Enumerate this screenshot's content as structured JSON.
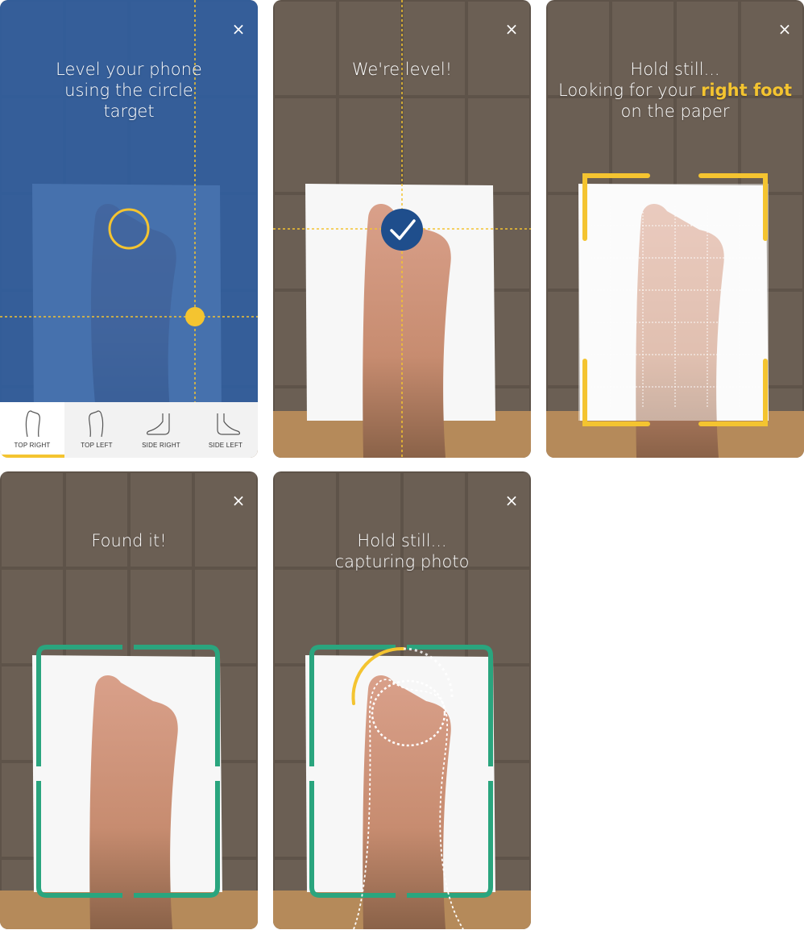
{
  "screens": [
    {
      "message": "Level your phone using the circle target",
      "close": "×"
    },
    {
      "message": "We're level!",
      "close": "×"
    },
    {
      "message_line1": "Hold still...",
      "message_line2_pre": "Looking for your ",
      "message_highlight": "right foot",
      "message_post": " on the paper",
      "close": "×"
    },
    {
      "message": "Found it!",
      "close": "×"
    },
    {
      "message_line1": "Hold still...",
      "message_line2": "capturing photo",
      "close": "×"
    }
  ],
  "tabs": [
    {
      "label": "TOP RIGHT",
      "active": true
    },
    {
      "label": "TOP LEFT",
      "active": false
    },
    {
      "label": "SIDE RIGHT",
      "active": false
    },
    {
      "label": "SIDE LEFT",
      "active": false
    }
  ],
  "colors": {
    "accent_yellow": "#f4c430",
    "confirm_blue": "#1f4e8c",
    "frame_green": "#2aa57e",
    "overlay_blue": "#2d5fa3"
  },
  "icons": [
    "close-icon",
    "checkmark-icon",
    "foot-top-icon",
    "foot-side-icon"
  ]
}
